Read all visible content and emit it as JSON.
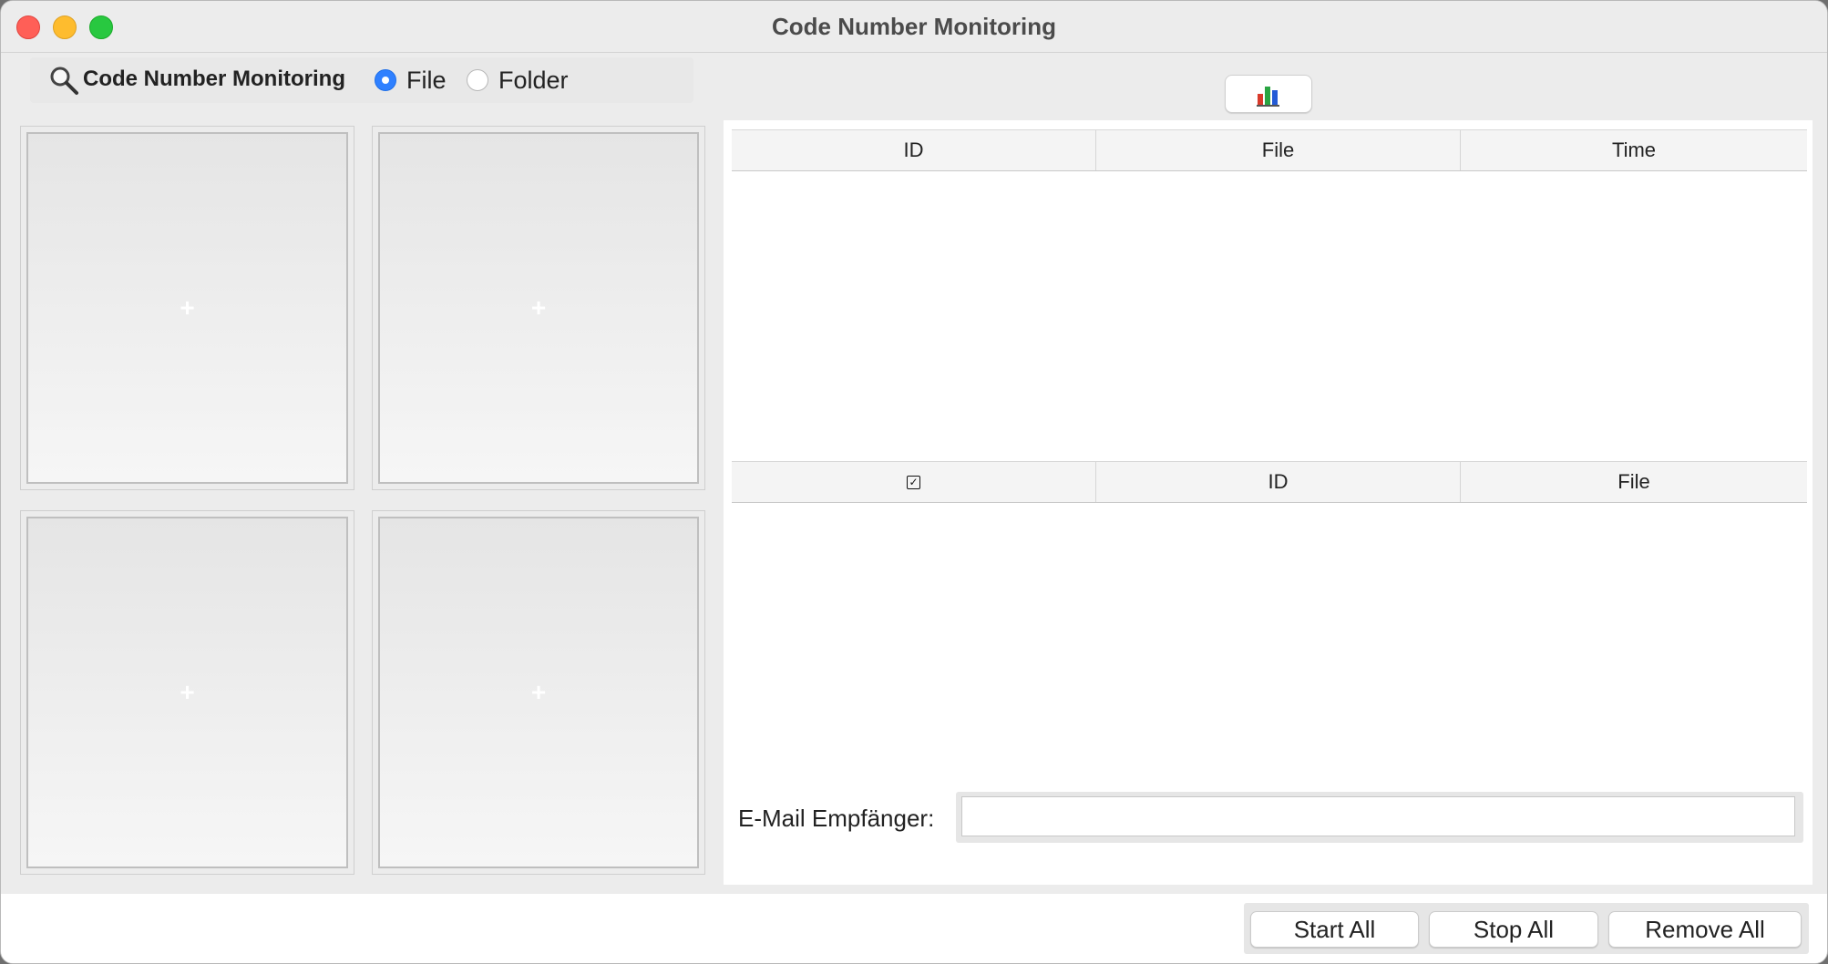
{
  "window": {
    "title": "Code Number Monitoring"
  },
  "toolbar": {
    "search_label": "Code Number Monitoring",
    "source_options": [
      {
        "label": "File",
        "selected": true
      },
      {
        "label": "Folder",
        "selected": false
      }
    ]
  },
  "preview_panels": [
    {
      "symbol": "+"
    },
    {
      "symbol": "+"
    },
    {
      "symbol": "+"
    },
    {
      "symbol": "+"
    }
  ],
  "chart_button": {
    "icon": "bar-chart-icon"
  },
  "monitor_table": {
    "columns": [
      "ID",
      "File",
      "Time"
    ],
    "rows": []
  },
  "selection_table": {
    "select_all_icon": "checkbox-icon",
    "columns": [
      "ID",
      "File"
    ],
    "rows": []
  },
  "email": {
    "label": "E-Mail Empfänger:",
    "value": ""
  },
  "actions": {
    "start_all": "Start All",
    "stop_all": "Stop All",
    "remove_all": "Remove All"
  },
  "colors": {
    "accent": "#2f80ff",
    "close": "#ff5f57",
    "minimize": "#febc2e",
    "maximize": "#28c840"
  }
}
